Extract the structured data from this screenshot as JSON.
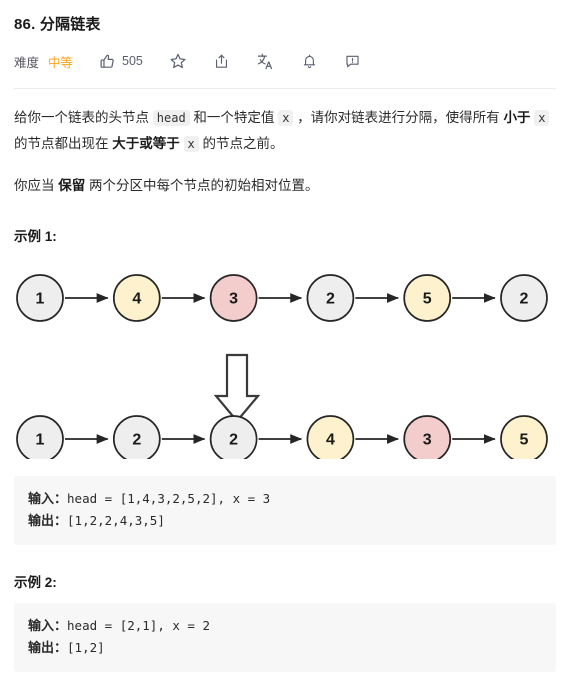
{
  "header": {
    "title": "86. 分隔链表",
    "difficulty_label": "难度",
    "difficulty_value": "中等",
    "difficulty_color": "#ffa116",
    "like_count": "505",
    "icons": [
      {
        "name": "thumbs-up-icon",
        "label": "505"
      },
      {
        "name": "star-icon",
        "label": ""
      },
      {
        "name": "share-icon",
        "label": ""
      },
      {
        "name": "translate-icon",
        "label": ""
      },
      {
        "name": "bell-icon",
        "label": ""
      },
      {
        "name": "feedback-icon",
        "label": ""
      }
    ]
  },
  "description": {
    "paragraph1": {
      "t1": "给你一个链表的头节点 ",
      "code1": "head",
      "t2": " 和一个特定值 ",
      "code2": "x",
      "t3": " ，请你对链表进行分隔，使得所有 ",
      "b1": "小于",
      "t4": " ",
      "code3": "x",
      "t5": " 的节点都出现在 ",
      "b2": "大于或等于",
      "t6": " ",
      "code4": "x",
      "t7": " 的节点之前。"
    },
    "paragraph2": {
      "t1": "你应当 ",
      "b1": "保留",
      "t2": " 两个分区中每个节点的初始相对位置。"
    }
  },
  "examples": [
    {
      "heading": "示例 1:",
      "input_label": "输入：",
      "input_value": "head = [1,4,3,2,5,2], x = 3",
      "output_label": "输出：",
      "output_value": "[1,2,2,4,3,5]"
    },
    {
      "heading": "示例 2:",
      "input_label": "输入：",
      "input_value": "head = [2,1], x = 2",
      "output_label": "输出：",
      "output_value": "[1,2]"
    }
  ],
  "diagram": {
    "before_list": [
      {
        "value": "1",
        "fill": "#eeeeee"
      },
      {
        "value": "4",
        "fill": "#fdf2cd"
      },
      {
        "value": "3",
        "fill": "#f3cccc"
      },
      {
        "value": "2",
        "fill": "#eeeeee"
      },
      {
        "value": "5",
        "fill": "#fdf2cd"
      },
      {
        "value": "2",
        "fill": "#eeeeee"
      }
    ],
    "after_list": [
      {
        "value": "1",
        "fill": "#eeeeee"
      },
      {
        "value": "2",
        "fill": "#eeeeee"
      },
      {
        "value": "2",
        "fill": "#eeeeee"
      },
      {
        "value": "4",
        "fill": "#fdf2cd"
      },
      {
        "value": "3",
        "fill": "#f3cccc"
      },
      {
        "value": "5",
        "fill": "#fdf2cd"
      }
    ],
    "node_stroke": "#262626",
    "arrow_color": "#262626",
    "transform_arrow": "down-arrow"
  }
}
